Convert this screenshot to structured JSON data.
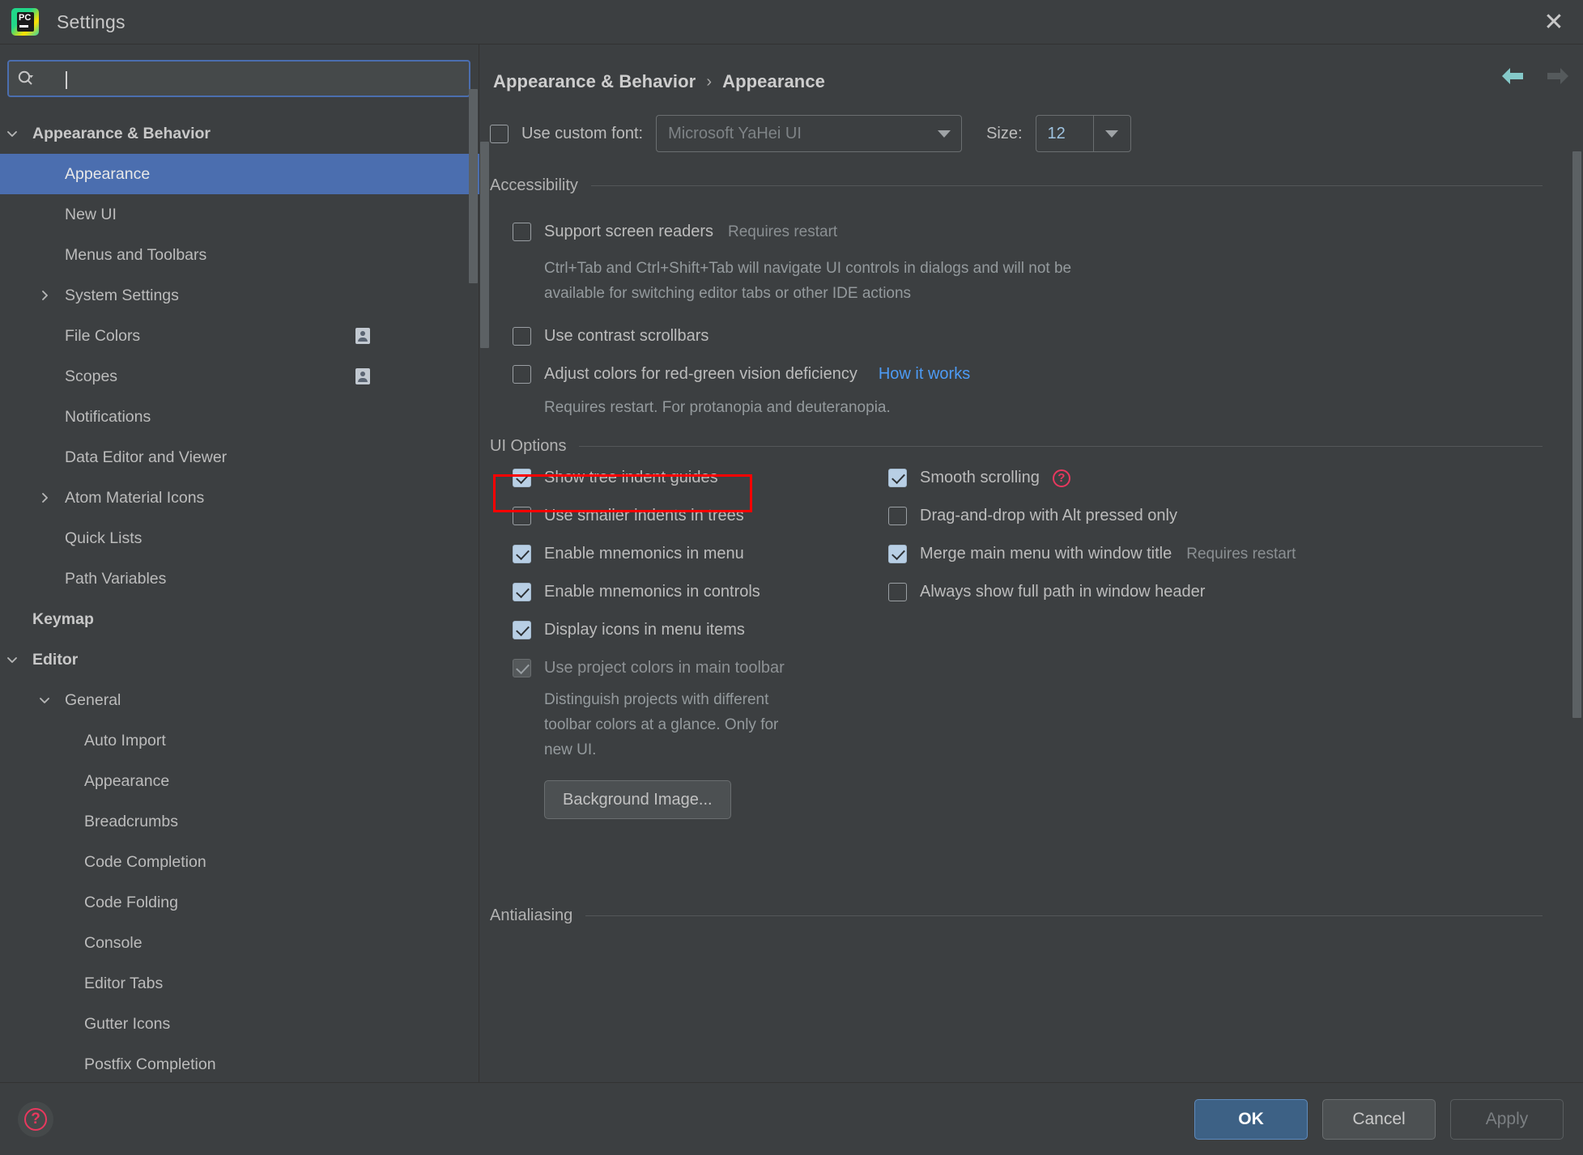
{
  "window": {
    "title": "Settings",
    "logo_text": "PC",
    "close_icon": "✕"
  },
  "search": {
    "placeholder": "",
    "value": "",
    "icon": "search-icon"
  },
  "sidebar": {
    "items": [
      {
        "label": "Appearance & Behavior",
        "indent": 0,
        "arrow": "down",
        "bold": true,
        "selected": false,
        "badge": false
      },
      {
        "label": "Appearance",
        "indent": 1,
        "arrow": "none",
        "bold": false,
        "selected": true,
        "badge": false
      },
      {
        "label": "New UI",
        "indent": 1,
        "arrow": "none",
        "bold": false,
        "selected": false,
        "badge": false
      },
      {
        "label": "Menus and Toolbars",
        "indent": 1,
        "arrow": "none",
        "bold": false,
        "selected": false,
        "badge": false
      },
      {
        "label": "System Settings",
        "indent": 1,
        "arrow": "right",
        "bold": false,
        "selected": false,
        "badge": false
      },
      {
        "label": "File Colors",
        "indent": 1,
        "arrow": "none",
        "bold": false,
        "selected": false,
        "badge": true
      },
      {
        "label": "Scopes",
        "indent": 1,
        "arrow": "none",
        "bold": false,
        "selected": false,
        "badge": true
      },
      {
        "label": "Notifications",
        "indent": 1,
        "arrow": "none",
        "bold": false,
        "selected": false,
        "badge": false
      },
      {
        "label": "Data Editor and Viewer",
        "indent": 1,
        "arrow": "none",
        "bold": false,
        "selected": false,
        "badge": false
      },
      {
        "label": "Atom Material Icons",
        "indent": 1,
        "arrow": "right",
        "bold": false,
        "selected": false,
        "badge": false
      },
      {
        "label": "Quick Lists",
        "indent": 1,
        "arrow": "none",
        "bold": false,
        "selected": false,
        "badge": false
      },
      {
        "label": "Path Variables",
        "indent": 1,
        "arrow": "none",
        "bold": false,
        "selected": false,
        "badge": false
      },
      {
        "label": "Keymap",
        "indent": 0,
        "arrow": "none",
        "bold": true,
        "selected": false,
        "badge": false
      },
      {
        "label": "Editor",
        "indent": 0,
        "arrow": "down",
        "bold": true,
        "selected": false,
        "badge": false
      },
      {
        "label": "General",
        "indent": 1,
        "arrow": "down",
        "bold": false,
        "selected": false,
        "badge": false
      },
      {
        "label": "Auto Import",
        "indent": 2,
        "arrow": "none",
        "bold": false,
        "selected": false,
        "badge": false
      },
      {
        "label": "Appearance",
        "indent": 2,
        "arrow": "none",
        "bold": false,
        "selected": false,
        "badge": false
      },
      {
        "label": "Breadcrumbs",
        "indent": 2,
        "arrow": "none",
        "bold": false,
        "selected": false,
        "badge": false
      },
      {
        "label": "Code Completion",
        "indent": 2,
        "arrow": "none",
        "bold": false,
        "selected": false,
        "badge": false
      },
      {
        "label": "Code Folding",
        "indent": 2,
        "arrow": "none",
        "bold": false,
        "selected": false,
        "badge": false
      },
      {
        "label": "Console",
        "indent": 2,
        "arrow": "none",
        "bold": false,
        "selected": false,
        "badge": false
      },
      {
        "label": "Editor Tabs",
        "indent": 2,
        "arrow": "none",
        "bold": false,
        "selected": false,
        "badge": false
      },
      {
        "label": "Gutter Icons",
        "indent": 2,
        "arrow": "none",
        "bold": false,
        "selected": false,
        "badge": false
      },
      {
        "label": "Postfix Completion",
        "indent": 2,
        "arrow": "none",
        "bold": false,
        "selected": false,
        "badge": false
      }
    ]
  },
  "breadcrumb": {
    "root": "Appearance & Behavior",
    "separator": "›",
    "current": "Appearance"
  },
  "nav": {
    "back_icon": "arrow-left-icon",
    "forward_icon": "arrow-right-icon",
    "back_color": "#85c9c9",
    "forward_color": "#555a5c"
  },
  "font_row": {
    "checkbox_label": "Use custom font:",
    "checked": false,
    "font_value": "Microsoft YaHei UI",
    "size_label": "Size:",
    "size_value": "12"
  },
  "accessibility": {
    "title": "Accessibility",
    "options": [
      {
        "label": "Support screen readers",
        "checked": false,
        "note": "Requires restart",
        "link": ""
      },
      {
        "label": "Use contrast scrollbars",
        "checked": false,
        "note": "",
        "link": ""
      },
      {
        "label": "Adjust colors for red-green vision deficiency",
        "checked": false,
        "note": "",
        "link": "How it works"
      }
    ],
    "screen_reader_desc_line1": "Ctrl+Tab and Ctrl+Shift+Tab will navigate UI controls in dialogs and will not be",
    "screen_reader_desc_line2": "available for switching editor tabs or other IDE actions",
    "color_desc": "Requires restart. For protanopia and deuteranopia."
  },
  "ui_options": {
    "title": "UI Options",
    "left_column": [
      {
        "label": "Show tree indent guides",
        "checked": true,
        "disabled": false,
        "highlighted": true
      },
      {
        "label": "Use smaller indents in trees",
        "checked": false,
        "disabled": false,
        "highlighted": false
      },
      {
        "label": "Enable mnemonics in menu",
        "checked": true,
        "disabled": false,
        "highlighted": false
      },
      {
        "label": "Enable mnemonics in controls",
        "checked": true,
        "disabled": false,
        "highlighted": false
      },
      {
        "label": "Display icons in menu items",
        "checked": true,
        "disabled": false,
        "highlighted": false
      },
      {
        "label": "Use project colors in main toolbar",
        "checked": true,
        "disabled": true,
        "highlighted": false
      }
    ],
    "project_colors_desc_line1": "Distinguish projects with different",
    "project_colors_desc_line2": "toolbar colors at a glance. Only for",
    "project_colors_desc_line3": "new UI.",
    "right_column": [
      {
        "label": "Smooth scrolling",
        "checked": true,
        "help": true,
        "note": ""
      },
      {
        "label": "Drag-and-drop with Alt pressed only",
        "checked": false,
        "help": false,
        "note": ""
      },
      {
        "label": "Merge main menu with window title",
        "checked": true,
        "help": false,
        "note": "Requires restart"
      },
      {
        "label": "Always show full path in window header",
        "checked": false,
        "help": false,
        "note": ""
      }
    ],
    "background_image_button": "Background Image..."
  },
  "antialiasing": {
    "title": "Antialiasing"
  },
  "footer": {
    "help_icon": "?",
    "ok": "OK",
    "cancel": "Cancel",
    "apply": "Apply"
  },
  "colors": {
    "accent": "#4b6eaf",
    "link": "#4d9bf5",
    "highlight": "#ff0000",
    "background": "#3c3f41"
  }
}
